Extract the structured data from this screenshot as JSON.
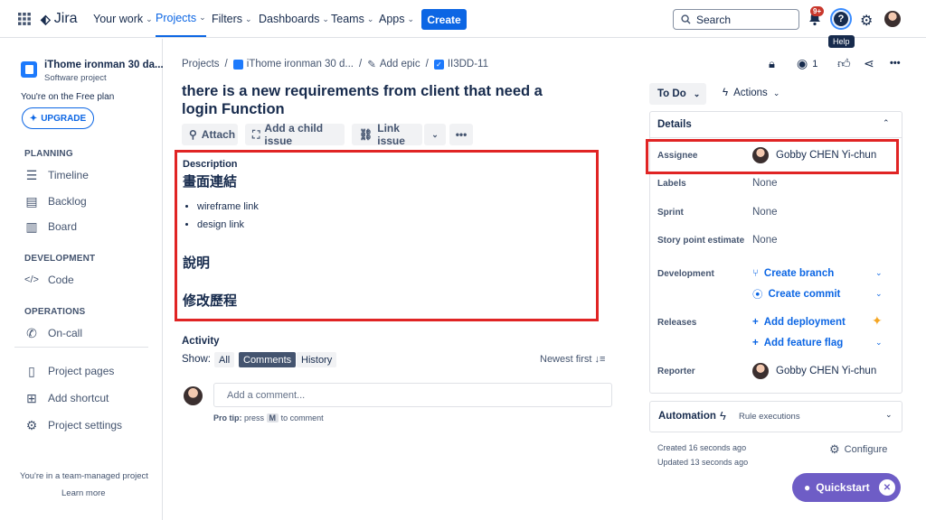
{
  "topbar": {
    "app_name": "Jira",
    "nav": [
      "Your work",
      "Projects",
      "Filters",
      "Dashboards",
      "Teams",
      "Apps"
    ],
    "create_label": "Create",
    "search_placeholder": "Search",
    "notif_badge": "9+",
    "help_tooltip": "Help"
  },
  "sidebar": {
    "project_name": "iThome ironman 30 da...",
    "project_type": "Software project",
    "plan_note": "You're on the Free plan",
    "upgrade_label": "UPGRADE",
    "planning_h": "PLANNING",
    "planning": [
      "Timeline",
      "Backlog",
      "Board"
    ],
    "development_h": "DEVELOPMENT",
    "development": [
      "Code"
    ],
    "operations_h": "OPERATIONS",
    "operations": [
      "On-call"
    ],
    "extra": [
      "Project pages",
      "Add shortcut",
      "Project settings"
    ],
    "footer_note": "You're in a team-managed project",
    "learn_more": "Learn more"
  },
  "breadcrumb": {
    "projects": "Projects",
    "project": "iThome ironman 30 d...",
    "add_epic": "Add epic",
    "issue_key": "II3DD-11"
  },
  "issue": {
    "title": "there is a new requirements from client that need a login Function",
    "actions": {
      "attach": "Attach",
      "child": "Add a child issue",
      "link": "Link issue"
    },
    "desc_label": "Description",
    "desc_h1": "畫面連結",
    "desc_list": [
      "wireframe link",
      "design link"
    ],
    "desc_h2": "說明",
    "desc_h3": "修改歷程"
  },
  "activity": {
    "title": "Activity",
    "show_label": "Show:",
    "filters": [
      "All",
      "Comments",
      "History"
    ],
    "sort": "Newest first",
    "comment_placeholder": "Add a comment...",
    "protip_prefix": "Pro tip:",
    "protip_mid": "press",
    "protip_key": "M",
    "protip_suffix": "to comment"
  },
  "right": {
    "watch_count": "1",
    "status": "To Do",
    "actions": "Actions",
    "details_title": "Details",
    "assignee_label": "Assignee",
    "assignee": "Gobby CHEN Yi-chun",
    "labels_label": "Labels",
    "labels": "None",
    "sprint_label": "Sprint",
    "sprint": "None",
    "story_label": "Story point estimate",
    "story": "None",
    "dev_label": "Development",
    "create_branch": "Create branch",
    "create_commit": "Create commit",
    "releases_label": "Releases",
    "add_deployment": "Add deployment",
    "add_flag": "Add feature flag",
    "reporter_label": "Reporter",
    "reporter": "Gobby CHEN Yi-chun",
    "automation": "Automation",
    "rule_exec": "Rule executions",
    "created": "Created 16 seconds ago",
    "updated": "Updated 13 seconds ago",
    "configure": "Configure",
    "quickstart": "Quickstart"
  }
}
